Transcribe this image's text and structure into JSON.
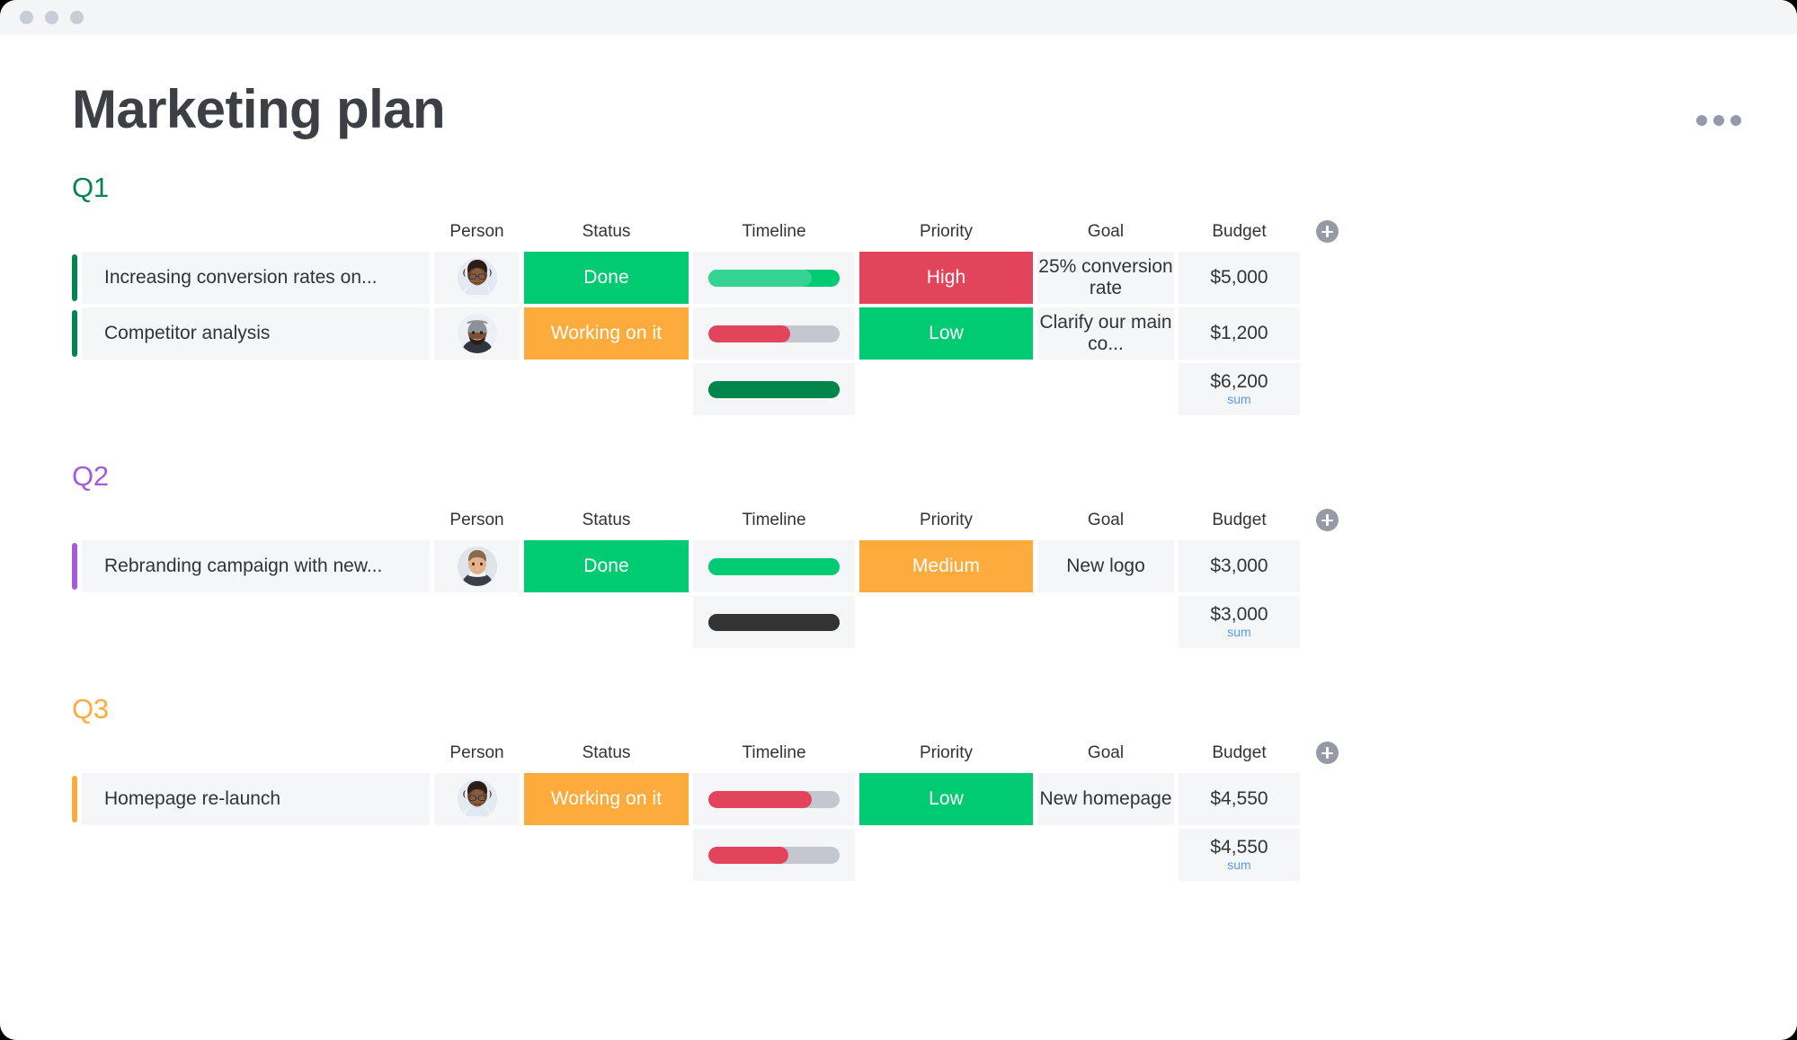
{
  "window": {
    "titlebar_dots": 3
  },
  "header": {
    "title": "Marketing plan",
    "menu_icon": "ellipsis-icon"
  },
  "colors": {
    "green": "#00ca72",
    "dark_green": "#00854d",
    "orange": "#fdab3d",
    "red": "#e2445c",
    "purple": "#a25ddc",
    "gray_track": "#c5c7d0",
    "dark_bar": "#333333",
    "sum_link": "#579bfc",
    "cell_bg": "#f5f6f8",
    "text": "#323338"
  },
  "columns": {
    "name": "",
    "person": "Person",
    "status": "Status",
    "timeline": "Timeline",
    "priority": "Priority",
    "goal": "Goal",
    "budget": "Budget",
    "add": "add-column-icon"
  },
  "groups": [
    {
      "title": "Q1",
      "color": "#00854d",
      "accent": "#00854d",
      "rows": [
        {
          "name": "Increasing conversion rates on...",
          "person": "avatar-woman-glasses",
          "status": {
            "label": "Done",
            "color": "#00ca72"
          },
          "timeline": {
            "fill_pct": 79,
            "fill_color": "#33d391",
            "track_color": "#00ca72"
          },
          "priority": {
            "label": "High",
            "color": "#e2445c"
          },
          "goal": "25% conversion rate",
          "budget": "$5,000"
        },
        {
          "name": "Competitor analysis",
          "person": "avatar-man-beard",
          "status": {
            "label": "Working on it",
            "color": "#fdab3d"
          },
          "timeline": {
            "fill_pct": 62,
            "fill_color": "#e2445c",
            "track_color": "#c5c7d0"
          },
          "priority": {
            "label": "Low",
            "color": "#00ca72"
          },
          "goal": "Clarify our main co...",
          "budget": "$1,200"
        }
      ],
      "summary": {
        "timeline": {
          "fill_pct": 100,
          "fill_color": "#00854d",
          "track_color": "#00854d"
        },
        "budget_value": "$6,200",
        "budget_label": "sum"
      }
    },
    {
      "title": "Q2",
      "color": "#a25ddc",
      "accent": "#a25ddc",
      "rows": [
        {
          "name": "Rebranding campaign with new...",
          "person": "avatar-man-smiling",
          "status": {
            "label": "Done",
            "color": "#00ca72"
          },
          "timeline": {
            "fill_pct": 100,
            "fill_color": "#00ca72",
            "track_color": "#00ca72"
          },
          "priority": {
            "label": "Medium",
            "color": "#fdab3d"
          },
          "goal": "New logo",
          "budget": "$3,000"
        }
      ],
      "summary": {
        "timeline": {
          "fill_pct": 100,
          "fill_color": "#333333",
          "track_color": "#333333"
        },
        "budget_value": "$3,000",
        "budget_label": "sum"
      }
    },
    {
      "title": "Q3",
      "color": "#fdab3d",
      "accent": "#fdab3d",
      "rows": [
        {
          "name": "Homepage re-launch",
          "person": "avatar-woman-glasses",
          "status": {
            "label": "Working on it",
            "color": "#fdab3d"
          },
          "timeline": {
            "fill_pct": 79,
            "fill_color": "#e2445c",
            "track_color": "#c5c7d0"
          },
          "priority": {
            "label": "Low",
            "color": "#00ca72"
          },
          "goal": "New homepage",
          "budget": "$4,550"
        }
      ],
      "summary": {
        "timeline": {
          "fill_pct": 61,
          "fill_color": "#e2445c",
          "track_color": "#c5c7d0"
        },
        "budget_value": "$4,550",
        "budget_label": "sum"
      }
    }
  ]
}
